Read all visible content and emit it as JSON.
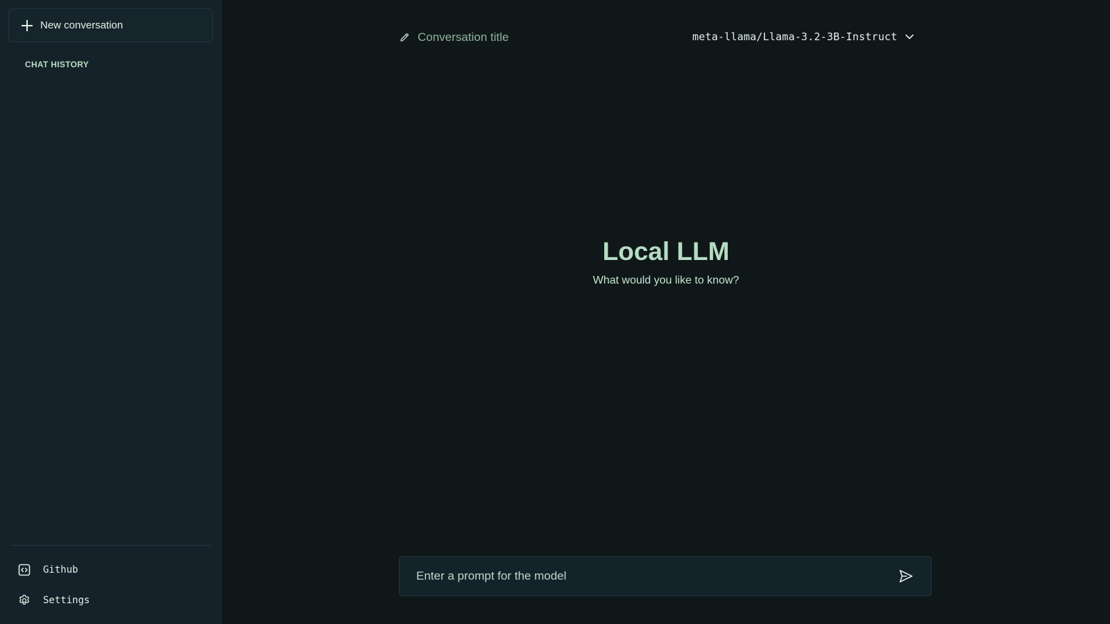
{
  "sidebar": {
    "new_conversation_label": "New conversation",
    "history_heading": "CHAT HISTORY",
    "links": [
      {
        "label": "Github",
        "icon": "code-box-icon"
      },
      {
        "label": "Settings",
        "icon": "gear-icon"
      }
    ]
  },
  "header": {
    "conversation_title_placeholder": "Conversation title",
    "model_name": "meta-llama/Llama-3.2-3B-Instruct"
  },
  "hero": {
    "title": "Local LLM",
    "subtitle": "What would you like to know?"
  },
  "prompt": {
    "placeholder": "Enter a prompt for the model",
    "value": ""
  },
  "colors": {
    "background": "#101719",
    "sidebar": "#15222a",
    "accent": "#b5dcc2",
    "text": "#e4f0e8"
  }
}
